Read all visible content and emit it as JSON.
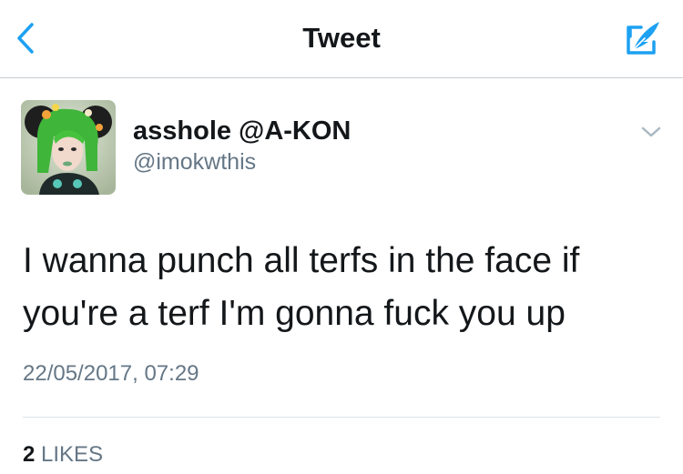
{
  "navbar": {
    "title": "Tweet",
    "back_icon": "chevron-left-icon",
    "compose_icon": "compose-tweet-icon",
    "accent_color": "#1da1f2"
  },
  "tweet": {
    "author": {
      "display_name": "asshole @A-KON",
      "handle": "@imokwthis"
    },
    "text": "I wanna punch all terfs in the face if\nyou're a terf I'm gonna fuck you up",
    "timestamp": "22/05/2017, 07:29",
    "menu_icon": "chevron-down-icon",
    "likes": {
      "count": "2",
      "label": "LIKES"
    }
  }
}
